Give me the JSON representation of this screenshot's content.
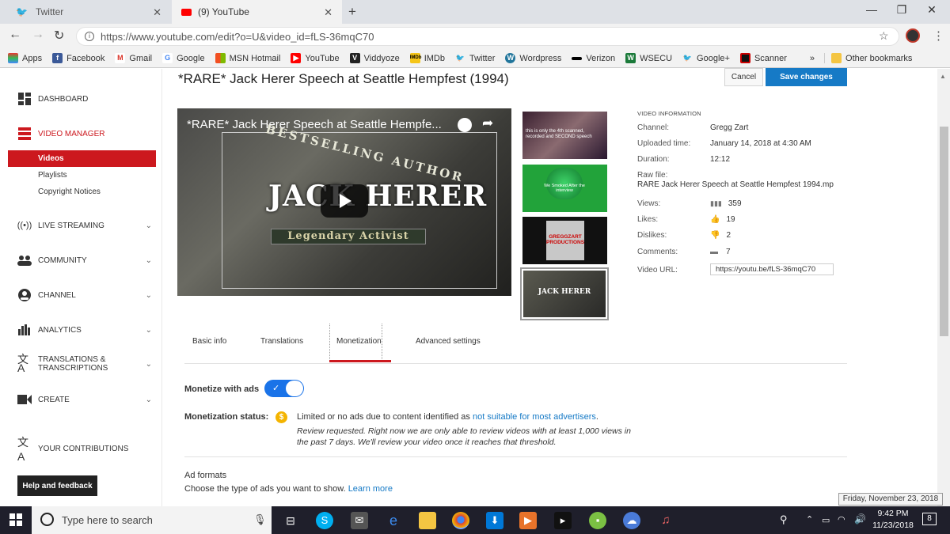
{
  "browser": {
    "tabs": [
      {
        "label": "Twitter"
      },
      {
        "label": "(9) YouTube"
      }
    ],
    "url": "https://www.youtube.com/edit?o=U&video_id=fLS-36mqC70",
    "bookmarks": [
      "Apps",
      "Facebook",
      "Gmail",
      "Google",
      "MSN Hotmail",
      "YouTube",
      "Viddyoze",
      "IMDb",
      "Twitter",
      "Wordpress",
      "Verizon",
      "WSECU",
      "Google+",
      "Scanner"
    ],
    "other_bookmarks": "Other bookmarks",
    "overflow": "»"
  },
  "sidebar": {
    "dashboard": "DASHBOARD",
    "video_manager": "VIDEO MANAGER",
    "videos": "Videos",
    "playlists": "Playlists",
    "copyright": "Copyright Notices",
    "live": "LIVE STREAMING",
    "community": "COMMUNITY",
    "channel": "CHANNEL",
    "analytics": "ANALYTICS",
    "translations": "TRANSLATIONS & TRANSCRIPTIONS",
    "create": "CREATE",
    "contributions": "YOUR CONTRIBUTIONS",
    "help": "Help and feedback"
  },
  "header": {
    "title": "*RARE* Jack Herer Speech at Seattle Hempfest (1994)",
    "cancel": "Cancel",
    "save": "Save changes"
  },
  "player": {
    "title": "*RARE* Jack Herer Speech at Seattle Hempfe...",
    "banner_top": "BESTSELLING AUTHOR",
    "name": "JACK HERER",
    "subtitle": "Legendary Activist"
  },
  "thumbnails": {
    "t1": "this is only the 4th scanned, recorded and SECOND speech",
    "t2": "We Smoked After the interview",
    "t3": "GREGGZART PRODUCTIONS",
    "t4": "JACK HERER"
  },
  "video_info": {
    "heading": "VIDEO INFORMATION",
    "channel_label": "Channel:",
    "channel": "Gregg Zart",
    "uploaded_label": "Uploaded time:",
    "uploaded": "January 14, 2018 at 4:30 AM",
    "duration_label": "Duration:",
    "duration": "12:12",
    "rawfile_label": "Raw file:",
    "rawfile": "RARE Jack Herer Speech at Seattle Hempfest 1994.mp",
    "views_label": "Views:",
    "views": "359",
    "likes_label": "Likes:",
    "likes": "19",
    "dislikes_label": "Dislikes:",
    "dislikes": "2",
    "comments_label": "Comments:",
    "comments": "7",
    "url_label": "Video URL:",
    "url": "https://youtu.be/fLS-36mqC70"
  },
  "tabs": {
    "basic": "Basic info",
    "translations": "Translations",
    "monetization": "Monetization",
    "advanced": "Advanced settings"
  },
  "monetization": {
    "toggle_label": "Monetize with ads",
    "toggle_on": true,
    "status_label": "Monetization status:",
    "status_text": "Limited or no ads due to content identified as ",
    "status_link": "not suitable for most advertisers",
    "status_end": ".",
    "review_line1": "Review requested.   Right now we are only able to review videos with at least 1,000 views in",
    "review_line2": "the past 7 days.   We'll review your video once it reaches that threshold."
  },
  "ad_formats": {
    "title": "Ad formats",
    "desc": "Choose the type of ads you want to show. ",
    "learn_more": "Learn more"
  },
  "taskbar": {
    "search_placeholder": "Type here to search",
    "time": "9:42 PM",
    "date": "11/23/2018",
    "tooltip": "Friday, November 23, 2018",
    "notifications": "8"
  },
  "colors": {
    "accent_red": "#cc181e",
    "save_blue": "#167ac6",
    "toggle_blue": "#1a73e8"
  }
}
